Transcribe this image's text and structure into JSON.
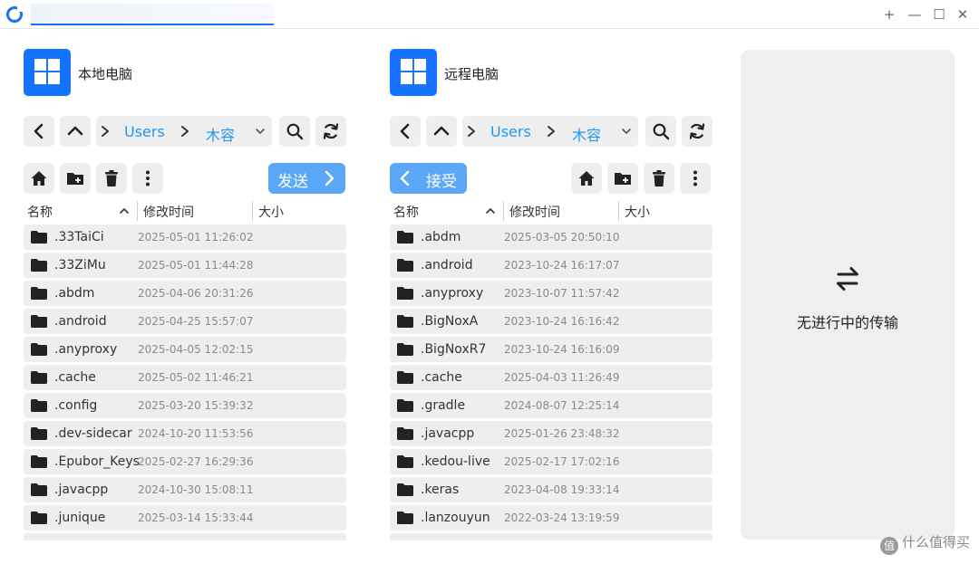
{
  "titlebar": {
    "window_controls": {
      "new": "+",
      "minimize": "—",
      "maximize": "☐",
      "close": "✕"
    }
  },
  "local": {
    "title": "本地电脑",
    "path": [
      "Users",
      "木容"
    ],
    "transfer_label": "发送",
    "columns": {
      "name": "名称",
      "modified": "修改时间",
      "size": "大小"
    },
    "files": [
      {
        "name": ".33TaiCi",
        "modified": "2025-05-01 11:26:02"
      },
      {
        "name": ".33ZiMu",
        "modified": "2025-05-01 11:44:28"
      },
      {
        "name": ".abdm",
        "modified": "2025-04-06 20:31:26"
      },
      {
        "name": ".android",
        "modified": "2025-04-25 15:57:07"
      },
      {
        "name": ".anyproxy",
        "modified": "2025-04-05 12:02:15"
      },
      {
        "name": ".cache",
        "modified": "2025-05-02 11:46:21"
      },
      {
        "name": ".config",
        "modified": "2025-03-20 15:39:32"
      },
      {
        "name": ".dev-sidecar",
        "modified": "2024-10-20 11:53:56"
      },
      {
        "name": ".Epubor_Keys",
        "modified": "2025-02-27 16:29:36"
      },
      {
        "name": ".javacpp",
        "modified": "2024-10-30 15:08:11"
      },
      {
        "name": ".junique",
        "modified": "2025-03-14 15:33:44"
      }
    ]
  },
  "remote": {
    "title": "远程电脑",
    "path": [
      "Users",
      "木容"
    ],
    "transfer_label": "接受",
    "columns": {
      "name": "名称",
      "modified": "修改时间",
      "size": "大小"
    },
    "files": [
      {
        "name": ".abdm",
        "modified": "2025-03-05 20:50:10"
      },
      {
        "name": ".android",
        "modified": "2023-10-24 16:17:07"
      },
      {
        "name": ".anyproxy",
        "modified": "2023-10-07 11:57:42"
      },
      {
        "name": ".BigNoxA",
        "modified": "2023-10-24 16:16:42"
      },
      {
        "name": ".BigNoxR7",
        "modified": "2023-10-24 16:16:09"
      },
      {
        "name": ".cache",
        "modified": "2025-04-03 11:26:49"
      },
      {
        "name": ".gradle",
        "modified": "2024-08-07 12:25:14"
      },
      {
        "name": ".javacpp",
        "modified": "2025-01-26 23:48:32"
      },
      {
        "name": ".kedou-live",
        "modified": "2025-02-17 17:02:16"
      },
      {
        "name": ".keras",
        "modified": "2023-04-08 19:33:14"
      },
      {
        "name": ".lanzouyun",
        "modified": "2022-03-24 13:19:59"
      }
    ]
  },
  "transfer_panel": {
    "empty_text": "无进行中的传输"
  },
  "watermark": {
    "badge": "值",
    "text": "什么值得买"
  },
  "colors": {
    "accent": "#1673ff",
    "link": "#2196f3",
    "button_bg": "#eeeeee",
    "transfer_button": "#5aa6f7"
  }
}
